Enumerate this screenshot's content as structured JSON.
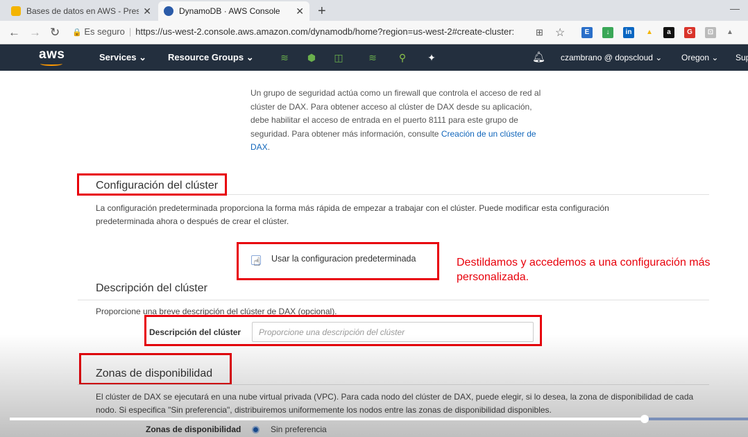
{
  "browser": {
    "tabs": [
      {
        "title": "Bases de datos en AWS - Presen",
        "favicon_color": "#f4b400"
      },
      {
        "title": "DynamoDB · AWS Console",
        "favicon_color": "#2b5ba8"
      }
    ],
    "secure_label": "Es seguro",
    "url": "https://us-west-2.console.aws.amazon.com/dynamodb/home?region=us-west-2#create-cluster:",
    "extension_badges": [
      "3",
      "6"
    ]
  },
  "aws_nav": {
    "logo": "aws",
    "services": "Services",
    "resource_groups": "Resource Groups",
    "user": "czambrano @ dopscloud",
    "region": "Oregon",
    "support": "Sup"
  },
  "security_group_text": {
    "body": "Un grupo de seguridad actúa como un firewall que controla el acceso de red al clúster de DAX. Para obtener acceso al clúster de DAX desde su aplicación, debe habilitar el acceso de entrada en el puerto 8111 para este grupo de seguridad. Para obtener más información, consulte",
    "link": "Creación de un clúster de DAX",
    "end": "."
  },
  "cluster_config": {
    "heading": "Configuración del clúster",
    "description": "La configuración predeterminada proporciona la forma más rápida de empezar a trabajar con el clúster. Puede modificar esta configuración predeterminada ahora o después de crear el clúster.",
    "checkbox_label": "Usar la configuracion predeterminada",
    "checked": false
  },
  "annotation": "Destildamos y accedemos a una configuración más personalizada.",
  "cluster_description": {
    "heading": "Descripción del clúster",
    "description": "Proporcione una breve descripción del clúster de DAX (opcional).",
    "field_label": "Descripción del clúster",
    "placeholder": "Proporcione una descripción del clúster",
    "value": ""
  },
  "availability_zones": {
    "heading": "Zonas de disponibilidad",
    "description": "El clúster de DAX se ejecutará en una nube virtual privada (VPC). Para cada nodo del clúster de DAX, puede elegir, si lo desea, la zona de disponibilidad de cada nodo. Si especifica \"Sin preferencia\", distribuiremos uniformemente los nodos entre las zonas de disponibilidad disponibles.",
    "field_label": "Zonas de disponibilidad",
    "option": "Sin preferencia"
  },
  "video": {
    "progress": 0.86
  }
}
